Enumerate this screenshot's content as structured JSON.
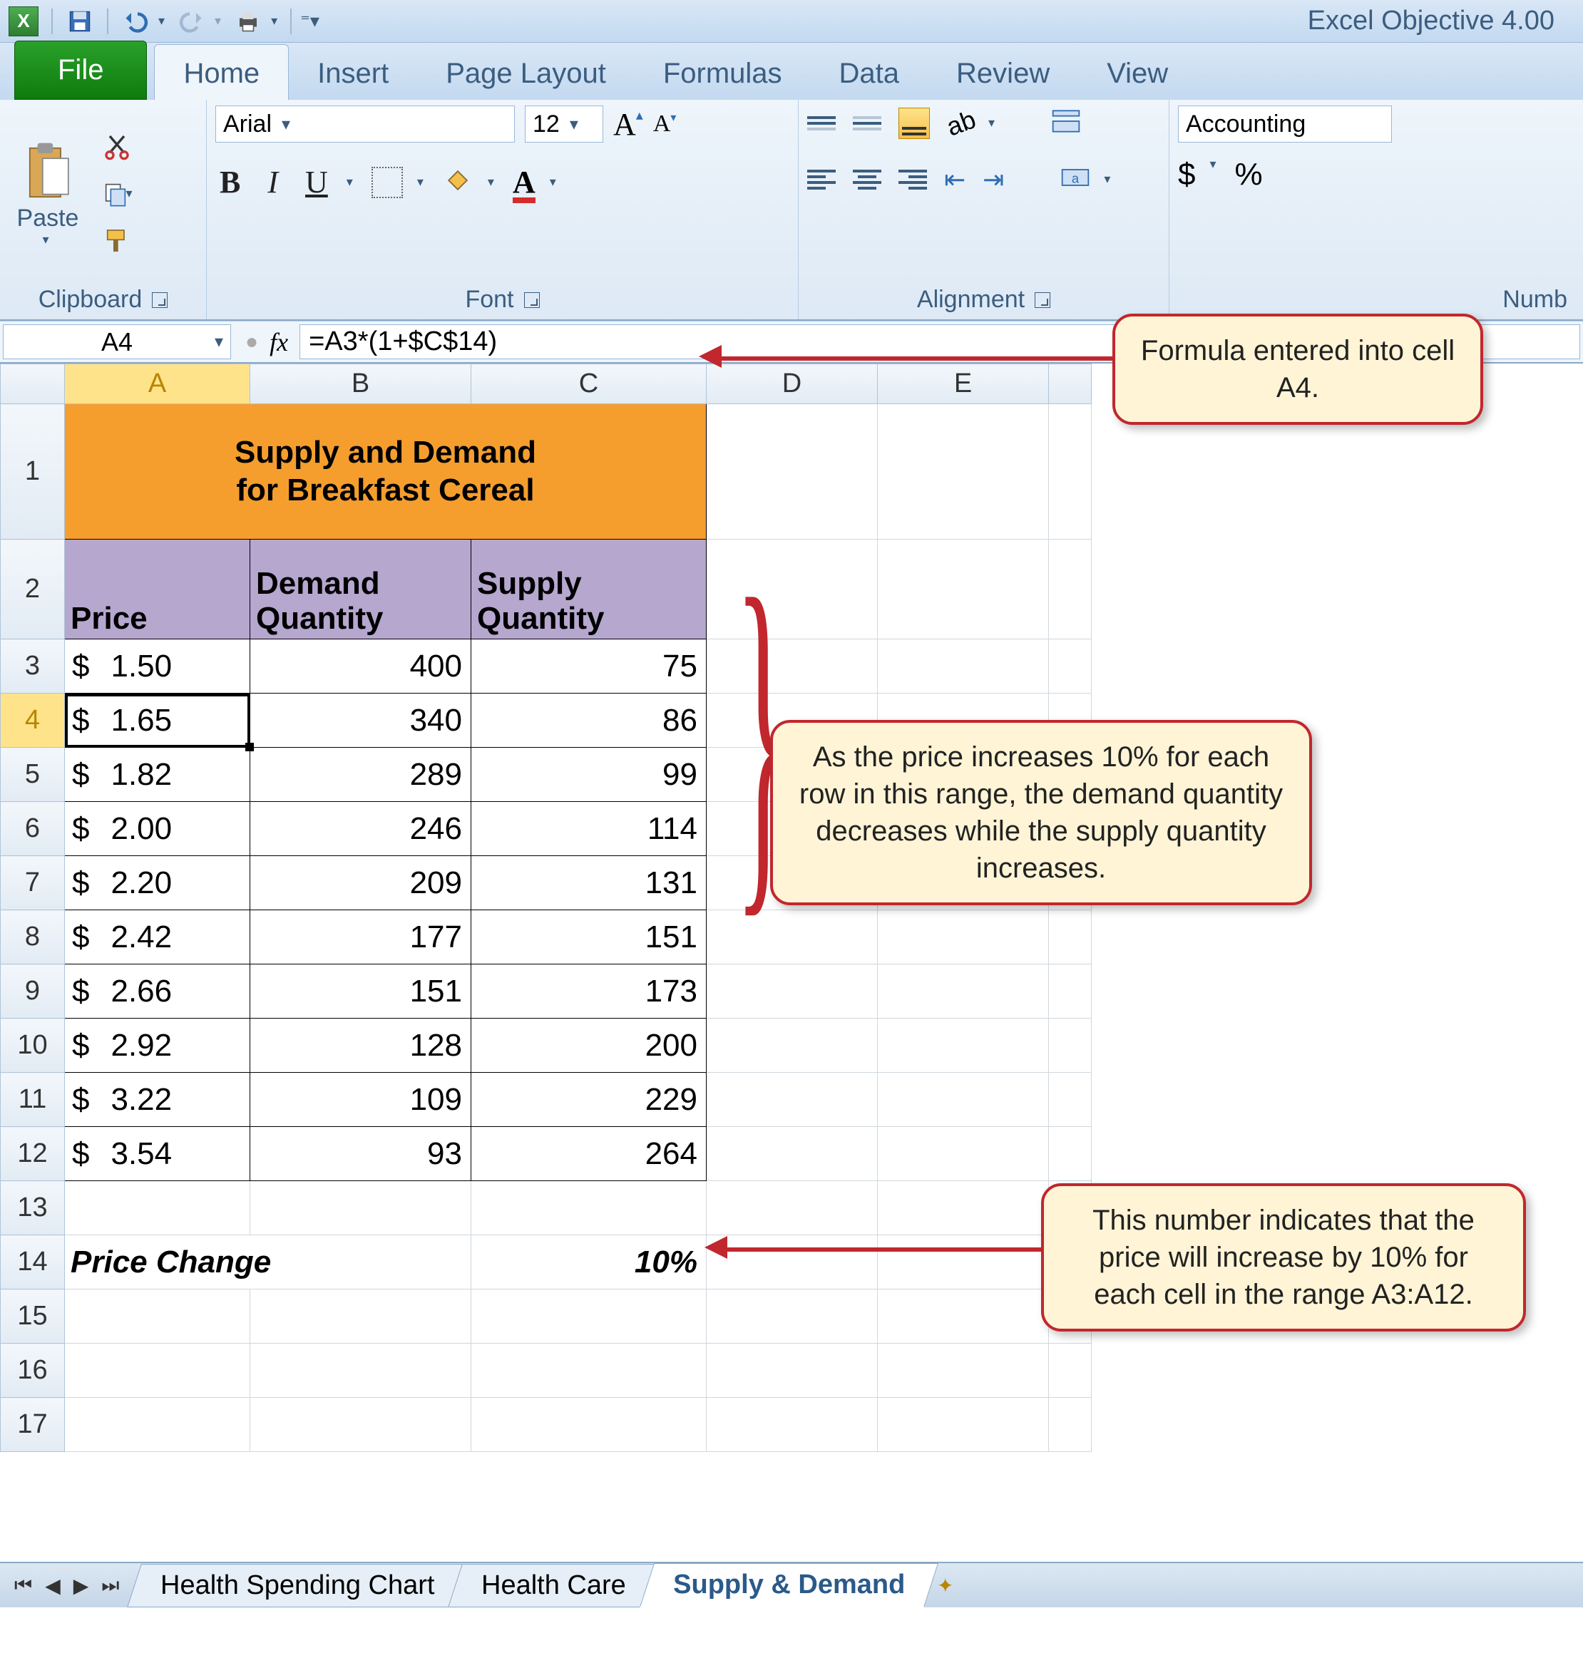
{
  "app": {
    "title": "Excel Objective 4.00"
  },
  "tabs": {
    "file": "File",
    "items": [
      "Home",
      "Insert",
      "Page Layout",
      "Formulas",
      "Data",
      "Review",
      "View"
    ],
    "active": "Home"
  },
  "ribbon": {
    "clipboard": {
      "label": "Clipboard",
      "paste": "Paste"
    },
    "font": {
      "label": "Font",
      "name": "Arial",
      "size": "12",
      "bold": "B",
      "italic": "I",
      "underline": "U"
    },
    "alignment": {
      "label": "Alignment"
    },
    "number": {
      "label": "Numb",
      "format": "Accounting",
      "currency": "$",
      "percent": "%"
    }
  },
  "formula_bar": {
    "cell_ref": "A4",
    "fx": "fx",
    "formula": "=A3*(1+$C$14)"
  },
  "columns": [
    "A",
    "B",
    "C",
    "D",
    "E"
  ],
  "sheet": {
    "title": "Supply and Demand for Breakfast Cereal",
    "headers": {
      "a": "Price",
      "b": "Demand Quantity",
      "c": "Supply Quantity"
    },
    "rows": [
      {
        "r": "3",
        "price": "1.50",
        "demand": "400",
        "supply": "75"
      },
      {
        "r": "4",
        "price": "1.65",
        "demand": "340",
        "supply": "86"
      },
      {
        "r": "5",
        "price": "1.82",
        "demand": "289",
        "supply": "99"
      },
      {
        "r": "6",
        "price": "2.00",
        "demand": "246",
        "supply": "114"
      },
      {
        "r": "7",
        "price": "2.20",
        "demand": "209",
        "supply": "131"
      },
      {
        "r": "8",
        "price": "2.42",
        "demand": "177",
        "supply": "151"
      },
      {
        "r": "9",
        "price": "2.66",
        "demand": "151",
        "supply": "173"
      },
      {
        "r": "10",
        "price": "2.92",
        "demand": "128",
        "supply": "200"
      },
      {
        "r": "11",
        "price": "3.22",
        "demand": "109",
        "supply": "229"
      },
      {
        "r": "12",
        "price": "3.54",
        "demand": "93",
        "supply": "264"
      }
    ],
    "empty_rows": [
      "13",
      "15",
      "16",
      "17"
    ],
    "price_change": {
      "row": "14",
      "label": "Price Change",
      "value": "10%"
    }
  },
  "sheet_tabs": {
    "items": [
      "Health Spending Chart",
      "Health Care",
      "Supply & Demand"
    ],
    "active": "Supply & Demand"
  },
  "callouts": {
    "formula": "Formula entered into cell A4.",
    "range": "As the price increases 10% for each row in this range, the demand quantity decreases while the supply quantity increases.",
    "pct": "This number indicates that the price will increase by 10% for each cell in the range A3:A12."
  },
  "chart_data": {
    "type": "table",
    "title": "Supply and Demand for Breakfast Cereal",
    "columns": [
      "Price",
      "Demand Quantity",
      "Supply Quantity"
    ],
    "rows": [
      [
        1.5,
        400,
        75
      ],
      [
        1.65,
        340,
        86
      ],
      [
        1.82,
        289,
        99
      ],
      [
        2.0,
        246,
        114
      ],
      [
        2.2,
        209,
        131
      ],
      [
        2.42,
        177,
        151
      ],
      [
        2.66,
        151,
        173
      ],
      [
        2.92,
        128,
        200
      ],
      [
        3.22,
        109,
        229
      ],
      [
        3.54,
        93,
        264
      ]
    ],
    "price_change_pct": 10
  }
}
